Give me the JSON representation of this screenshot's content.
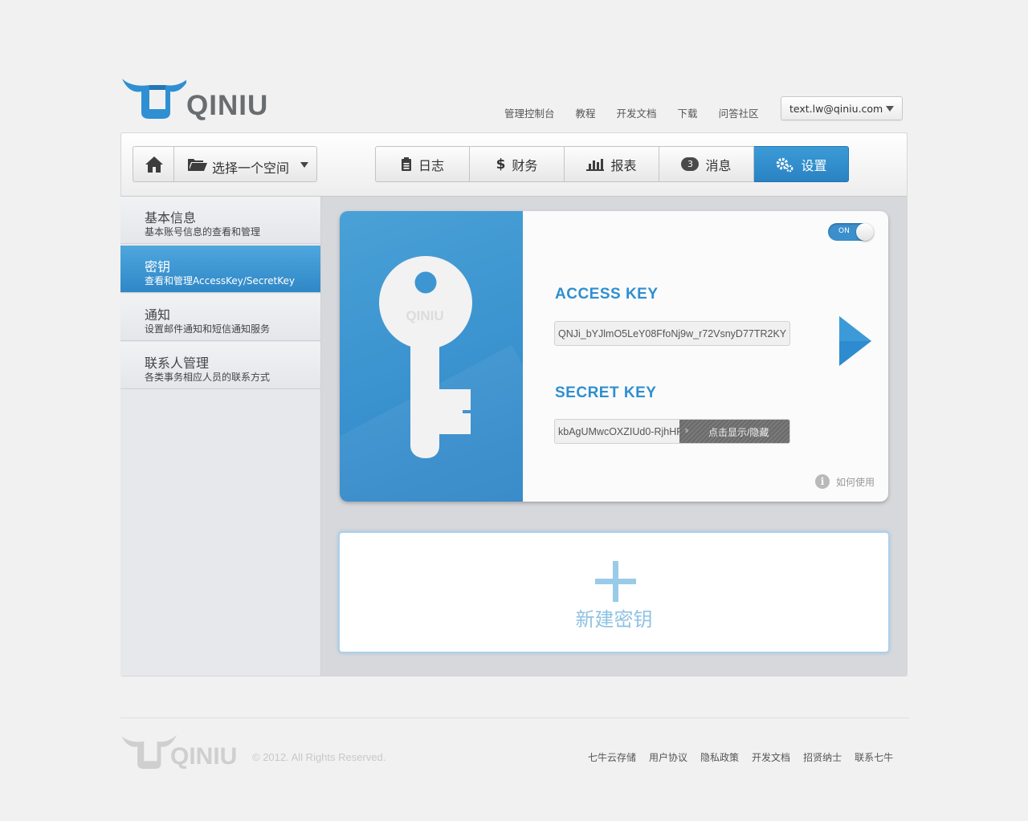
{
  "brand": {
    "name": "QINIU"
  },
  "topnav": [
    "管理控制台",
    "教程",
    "开发文档",
    "下载",
    "问答社区"
  ],
  "user": {
    "email": "text.lw@qiniu.com"
  },
  "toolbar": {
    "space_select": "选择一个空间",
    "tabs": [
      {
        "label": "日志",
        "icon": "clipboard-icon"
      },
      {
        "label": "财务",
        "icon": "dollar-icon"
      },
      {
        "label": "报表",
        "icon": "bar-chart-icon"
      },
      {
        "label": "消息",
        "icon": "message-bubble-icon",
        "badge": "3"
      },
      {
        "label": "设置",
        "icon": "gears-icon",
        "active": true
      }
    ]
  },
  "sidebar": {
    "items": [
      {
        "title": "基本信息",
        "subtitle": "基本账号信息的查看和管理"
      },
      {
        "title": "密钥",
        "subtitle": "查看和管理AccessKey/SecretKey",
        "active": true
      },
      {
        "title": "通知",
        "subtitle": "设置邮件通知和短信通知服务"
      },
      {
        "title": "联系人管理",
        "subtitle": "各类事务相应人员的联系方式"
      }
    ]
  },
  "key_card": {
    "toggle": "ON",
    "access_key_label": "ACCESS  KEY",
    "access_key_value": "QNJi_bYJlmO5LeY08FfoNj9w_r72VsnyD77TR2KY",
    "secret_key_label": "SECRET KEY",
    "secret_key_value": "kbAgUMwcOXZIUd0-RjhHP",
    "reveal_label": "点击显示/隐藏",
    "help_label": "如何使用",
    "key_logo_text": "QINIU"
  },
  "new_key": {
    "label": "新建密钥"
  },
  "footer": {
    "copyright": "© 2012. All Rights Reserved.",
    "links": [
      "七牛云存储",
      "用户协议",
      "隐私政策",
      "开发文档",
      "招贤纳士",
      "联系七牛"
    ]
  },
  "colors": {
    "accent": "#2e8fd0",
    "active_tab": "#2a82c3",
    "new_key": "#99cbe8"
  }
}
